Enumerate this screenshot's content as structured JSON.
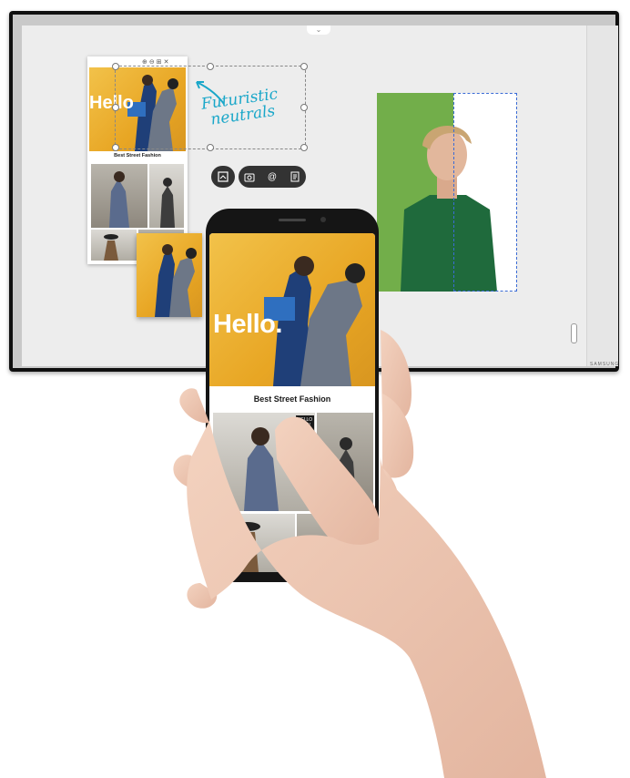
{
  "card": {
    "toolbar_icons": "⊕⊖⊞✕",
    "hello": "Hello",
    "title": "Best Street Fashion"
  },
  "annotation": {
    "line1": "Futuristic",
    "line2": "neutrals"
  },
  "pill_toolbar": {
    "icons": [
      "crop-icon",
      "camera-icon",
      "at-icon",
      "document-icon"
    ]
  },
  "phone": {
    "hello": "Hello.",
    "title": "Best Street Fashion",
    "badge": "HELLO NEW"
  },
  "display": {
    "logo": "SAMSUNG"
  },
  "colors": {
    "annotation": "#1aa7c9",
    "crop_outline": "#3a6bd6",
    "photo_background": "#72ae4a"
  }
}
